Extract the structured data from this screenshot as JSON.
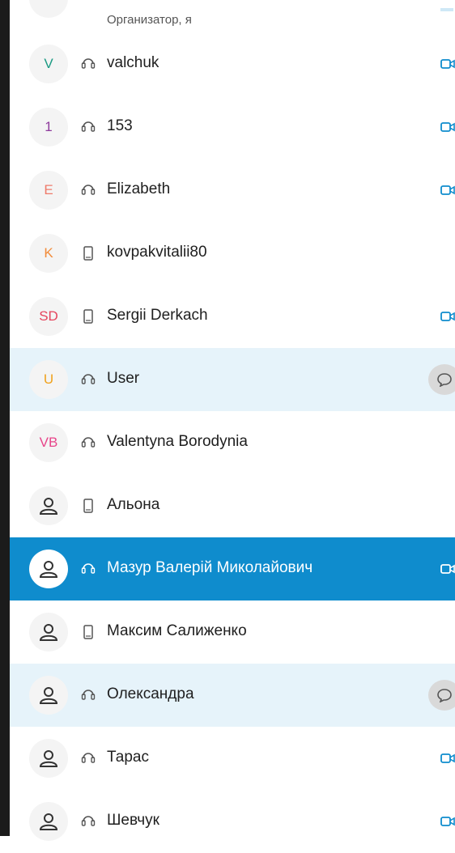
{
  "top_partial": {
    "subtitle": "Организатор, я"
  },
  "colors": {
    "selected_bg": "#0f8ccd",
    "highlight_bg": "#e6f3fa",
    "accent_icon": "#0f8ccd"
  },
  "participants": [
    {
      "name": "valchuk",
      "initials": "V",
      "initials_color": "#1a9a83",
      "status": "headset",
      "action": "video"
    },
    {
      "name": "153",
      "initials": "1",
      "initials_color": "#8e3a9c",
      "status": "headset",
      "action": "video"
    },
    {
      "name": "Elizabeth",
      "initials": "E",
      "initials_color": "#ef7b6b",
      "status": "headset",
      "action": "video"
    },
    {
      "name": "kovpakvitalii80",
      "initials": "K",
      "initials_color": "#f28c3a",
      "status": "phone",
      "action": "none"
    },
    {
      "name": "Sergii Derkach",
      "initials": "SD",
      "initials_color": "#e5455d",
      "status": "phone",
      "action": "video"
    },
    {
      "name": "User",
      "initials": "U",
      "initials_color": "#f0a21d",
      "status": "headset",
      "action": "chat",
      "highlighted": true
    },
    {
      "name": "Valentyna Borodynia",
      "initials": "VB",
      "initials_color": "#e7458a",
      "status": "headset",
      "action": "none"
    },
    {
      "name": "Альона",
      "initials": "",
      "status": "phone",
      "action": "none"
    },
    {
      "name": "Мазур Валерій Миколайович",
      "initials": "",
      "status": "headset",
      "action": "video",
      "selected": true
    },
    {
      "name": "Максим Салиженко",
      "initials": "",
      "status": "phone",
      "action": "none"
    },
    {
      "name": "Олександра",
      "initials": "",
      "status": "headset",
      "action": "chat",
      "highlighted": true
    },
    {
      "name": "Тарас",
      "initials": "",
      "status": "headset",
      "action": "video"
    },
    {
      "name": "Шевчук",
      "initials": "",
      "status": "headset",
      "action": "video"
    }
  ]
}
